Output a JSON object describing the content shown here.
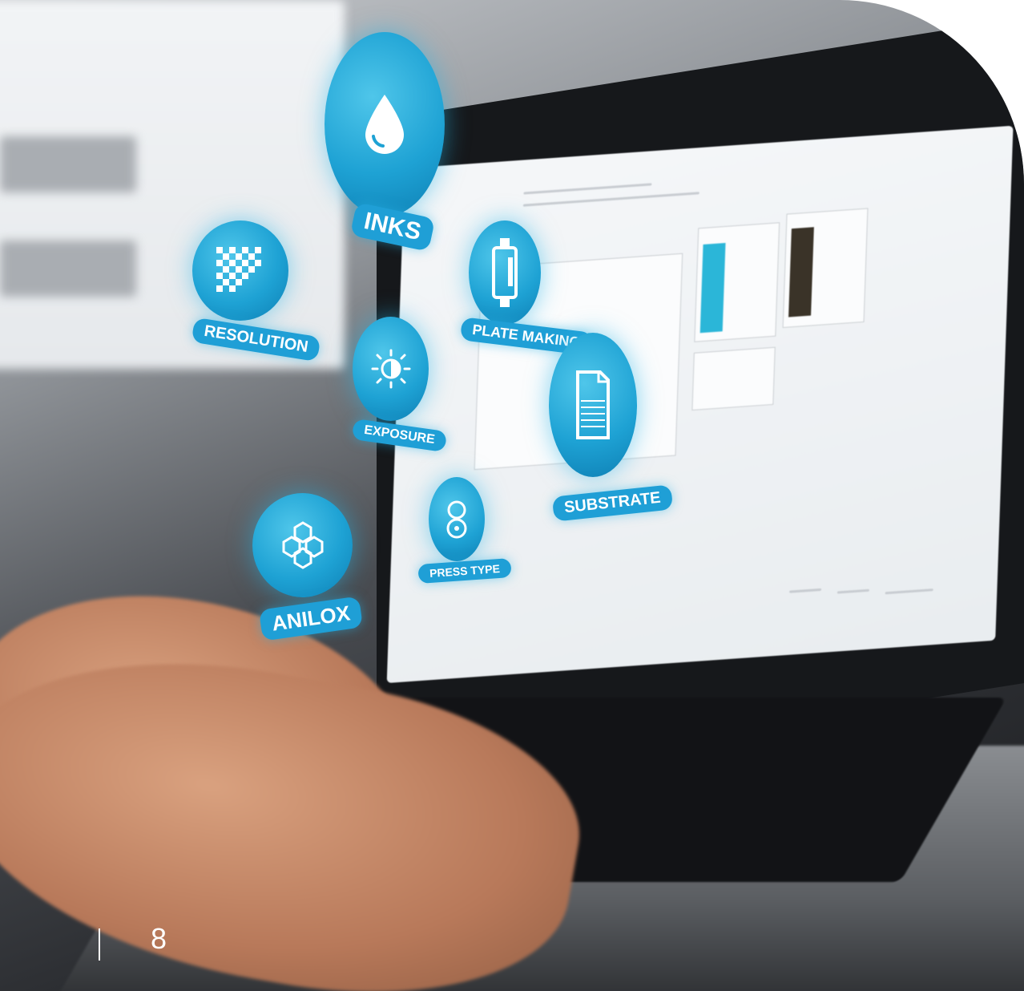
{
  "badges": {
    "inks": "INKS",
    "resolution": "RESOLUTION",
    "plate_making": "PLATE MAKING",
    "exposure": "EXPOSURE",
    "substrate": "SUBSTRATE",
    "press_type": "PRESS TYPE",
    "anilox": "ANILOX"
  },
  "page_number": "8",
  "colors": {
    "badge": "#1ea2d4",
    "screen_cyan": "#2bb6d8",
    "screen_dark": "#3a3328"
  },
  "icons": [
    "ink-drop-icon",
    "checkerboard-icon",
    "plate-roller-icon",
    "half-sun-icon",
    "document-icon",
    "press-rollers-icon",
    "honeycomb-icon"
  ]
}
